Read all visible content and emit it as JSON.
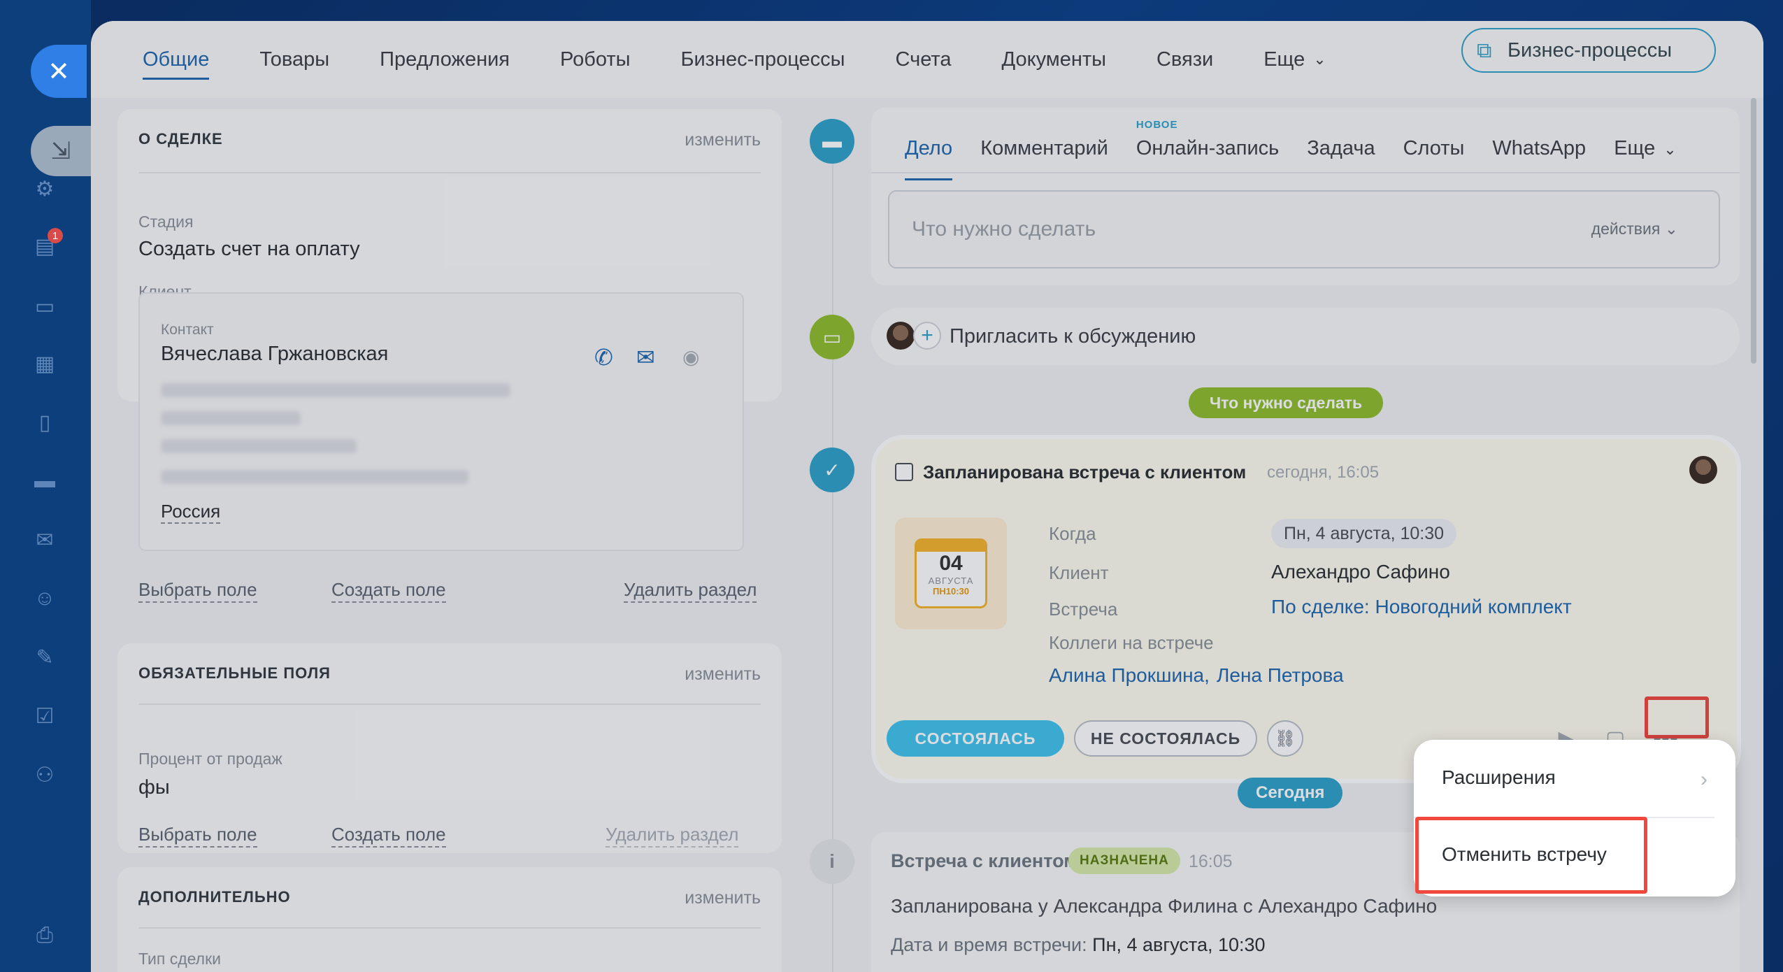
{
  "colors": {
    "accent": "#2067b0",
    "teal": "#2ea1c9",
    "green": "#8fbe2c",
    "highlight": "#f0473e",
    "done_button": "#40c4ef"
  },
  "sidebar": {
    "notification_count": "1"
  },
  "topnav": {
    "tabs": [
      {
        "label": "Общие",
        "active": true
      },
      {
        "label": "Товары"
      },
      {
        "label": "Предложения"
      },
      {
        "label": "Роботы"
      },
      {
        "label": "Бизнес-процессы"
      },
      {
        "label": "Счета"
      },
      {
        "label": "Документы"
      },
      {
        "label": "Связи"
      },
      {
        "label": "Еще"
      }
    ],
    "bp_button": "Бизнес-процессы"
  },
  "deal_card": {
    "title": "О СДЕЛКЕ",
    "edit": "изменить",
    "stage_label": "Стадия",
    "stage_value": "Создать счет на оплату",
    "client_label": "Клиент",
    "contact_label": "Контакт",
    "contact_name": "Вячеслава Гржановская",
    "country": "Россия",
    "select_field": "Выбрать поле",
    "create_field": "Создать поле",
    "delete_section": "Удалить раздел"
  },
  "required_card": {
    "title": "ОБЯЗАТЕЛЬНЫЕ ПОЛЯ",
    "edit": "изменить",
    "percent_label": "Процент от продаж",
    "percent_value": "фы",
    "select_field": "Выбрать поле",
    "create_field": "Создать поле",
    "delete_section": "Удалить раздел"
  },
  "extra_card": {
    "title": "ДОПОЛНИТЕЛЬНО",
    "edit": "изменить",
    "deal_type_label": "Тип сделки"
  },
  "composer": {
    "tabs": [
      "Дело",
      "Комментарий",
      "Онлайн-запись",
      "Задача",
      "Слоты",
      "WhatsApp",
      "Еще"
    ],
    "new_tag": "НОВОЕ",
    "placeholder": "Что нужно сделать",
    "actions": "действия"
  },
  "invite": {
    "label": "Пригласить к обсуждению"
  },
  "todo_pill": "Что нужно сделать",
  "today_pill": "Сегодня",
  "meeting": {
    "title": "Запланирована встреча с клиентом",
    "time": "сегодня, 16:05",
    "cal_day": "04",
    "cal_month": "АВГУСТА",
    "cal_dow": "ПН",
    "cal_time": "10:30",
    "when_label": "Когда",
    "when_value": "Пн, 4 августа, 10:30",
    "client_label": "Клиент",
    "client_value": "Алехандро Сафино",
    "meeting_label": "Встреча",
    "meeting_value": "По сделке: Новогодний комплект",
    "colleagues_label": "Коллеги на встрече",
    "colleague_1": "Алина Прокшина,",
    "colleague_2": "Лена Петрова",
    "done_btn": "СОСТОЯЛАСЬ",
    "not_done_btn": "НЕ СОСТОЯЛАСЬ"
  },
  "popup": {
    "extensions": "Расширения",
    "cancel_meeting": "Отменить встречу"
  },
  "info": {
    "title": "Встреча с клиентом",
    "status": "НАЗНАЧЕНА",
    "time": "16:05",
    "text": "Запланирована у Александра Филина с Алехандро Сафино",
    "datetime_label": "Дата и время встречи:",
    "datetime_value": "Пн, 4 августа, 10:30"
  }
}
